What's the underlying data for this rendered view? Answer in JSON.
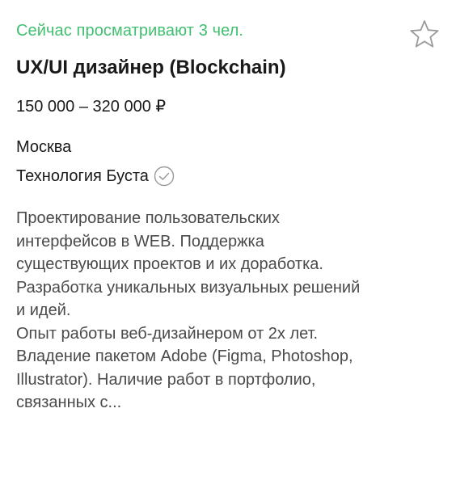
{
  "vacancy": {
    "viewers_text": "Сейчас просматривают 3 чел.",
    "title": "UX/UI дизайнер (Blockchain)",
    "salary": "150 000 – 320 000 ₽",
    "city": "Москва",
    "company": "Технология Буста",
    "company_verified_icon": "check-circle-icon",
    "favorite_icon": "star-outline-icon",
    "description_lines": [
      "Проектирование пользовательских",
      "интерфейсов в WEB. Поддержка",
      "существующих проектов и их доработка.",
      "Разработка уникальных визуальных решений",
      "и идей.",
      "Опыт работы веб-дизайнером от 2х лет.",
      "Владение пакетом Adobe (Figma, Photoshop,",
      "Illustrator). Наличие работ в портфолио,",
      "связанных с..."
    ]
  },
  "colors": {
    "viewers": "#3fbf6f",
    "title": "#1a1a1a",
    "description": "#4a4a4a",
    "icon": "#9a9a9a"
  }
}
